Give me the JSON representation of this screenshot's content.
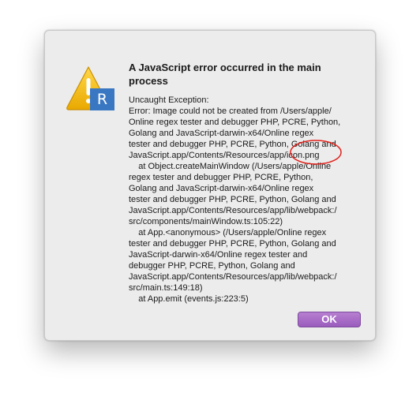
{
  "dialog": {
    "title": "A JavaScript error occurred in the main process",
    "badge_letter": "R",
    "icon": "warning-icon",
    "message_lines": [
      "Uncaught Exception:",
      "Error: Image could not be created from /Users/apple/",
      "Online regex tester and debugger PHP, PCRE, Python,",
      "Golang and JavaScript-darwin-x64/Online regex",
      "tester and debugger PHP, PCRE, Python, Golang and",
      "JavaScript.app/Contents/Resources/app/icon.png",
      "    at Object.createMainWindow (/Users/apple/Online",
      "regex tester and debugger PHP, PCRE, Python,",
      "Golang and JavaScript-darwin-x64/Online regex",
      "tester and debugger PHP, PCRE, Python, Golang and",
      "JavaScript.app/Contents/Resources/app/lib/webpack:/",
      "src/components/mainWindow.ts:105:22)",
      "    at App.<anonymous> (/Users/apple/Online regex",
      "tester and debugger PHP, PCRE, Python, Golang and",
      "JavaScript-darwin-x64/Online regex tester and",
      "debugger PHP, PCRE, Python, Golang and",
      "JavaScript.app/Contents/Resources/app/lib/webpack:/",
      "src/main.ts:149:18)",
      "    at App.emit (events.js:223:5)"
    ],
    "ok_label": "OK"
  },
  "colors": {
    "annotation": "#e0211b",
    "button": "#a96bc8",
    "badge": "#3a77c2",
    "warning": "#f2b705"
  }
}
